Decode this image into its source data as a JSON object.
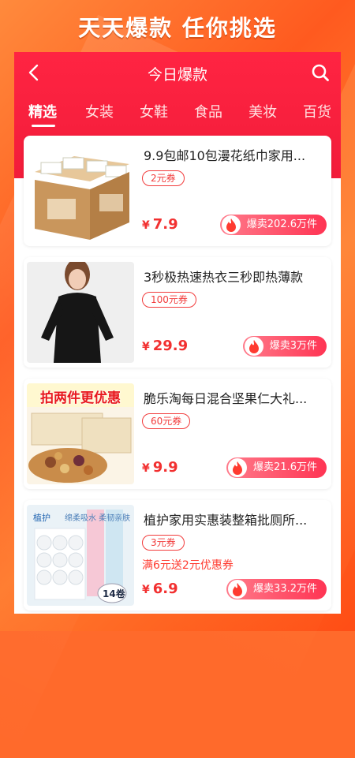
{
  "banner": "天天爆款 任你挑选",
  "header": {
    "title": "今日爆款"
  },
  "tabs": [
    "精选",
    "女装",
    "女鞋",
    "食品",
    "美妆",
    "百货"
  ],
  "active_tab": 0,
  "products": [
    {
      "title": "9.9包邮10包漫花纸巾家用...",
      "coupon": "2元券",
      "promo": "",
      "currency": "¥",
      "price": "7.9",
      "sold": "爆卖202.6万件"
    },
    {
      "title": "3秒极热速热衣三秒即热薄款",
      "coupon": "100元券",
      "promo": "",
      "currency": "¥",
      "price": "29.9",
      "sold": "爆卖3万件"
    },
    {
      "title": "脆乐淘每日混合坚果仁大礼...",
      "coupon": "60元券",
      "promo": "",
      "currency": "¥",
      "price": "9.9",
      "sold": "爆卖21.6万件",
      "image_overlay": "拍两件更优惠"
    },
    {
      "title": "植护家用实惠装整箱批厕所...",
      "coupon": "3元券",
      "promo": "满6元送2元优惠券",
      "currency": "¥",
      "price": "6.9",
      "sold": "爆卖33.2万件",
      "image_text": [
        "植护",
        "绵柔吸水 柔韧亲肤",
        "14卷"
      ]
    }
  ],
  "colors": {
    "brand_red": "#f21c3a",
    "price_red": "#f23030",
    "banner_orange": "#ff6a2b"
  },
  "icons": {
    "back": "chevron-left-icon",
    "search": "search-icon",
    "sold": "fire-icon"
  }
}
